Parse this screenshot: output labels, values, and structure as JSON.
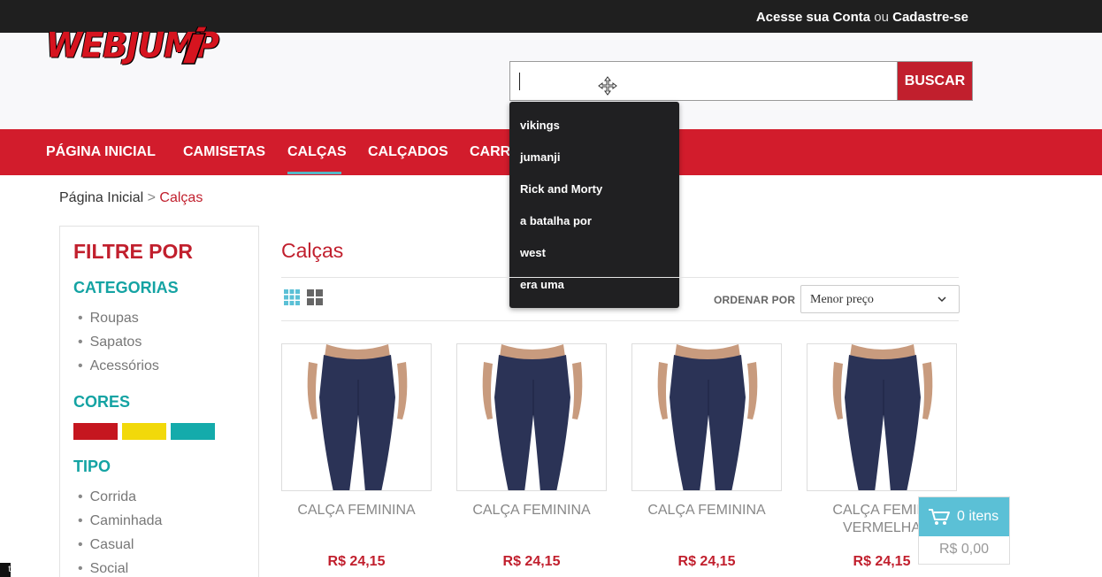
{
  "topbar": {
    "login_link": "Acesse sua Conta",
    "or_text": "ou",
    "register_link": "Cadastre-se"
  },
  "header": {
    "logo_text": "WEBJUMP",
    "search": {
      "value": "",
      "button_label": "BUSCAR"
    }
  },
  "nav": {
    "items": [
      {
        "label": "PÁGINA INICIAL",
        "active": false
      },
      {
        "label": "CAMISETAS",
        "active": false
      },
      {
        "label": "CALÇAS",
        "active": true
      },
      {
        "label": "CALÇADOS",
        "active": false
      },
      {
        "label": "CARRI",
        "active": false
      }
    ]
  },
  "search_suggestions": [
    "vikings",
    "jumanji",
    "Rick and Morty",
    "a batalha por",
    "west",
    "era uma"
  ],
  "breadcrumb": {
    "home": "Página Inicial",
    "separator": ">",
    "current": "Calças"
  },
  "sidebar": {
    "title": "FILTRE POR",
    "categories_heading": "CATEGORIAS",
    "categories": [
      "Roupas",
      "Sapatos",
      "Acessórios"
    ],
    "colors_heading": "CORES",
    "colors": [
      "#c5161f",
      "#f2d90a",
      "#14abab"
    ],
    "type_heading": "TIPO",
    "types": [
      "Corrida",
      "Caminhada",
      "Casual",
      "Social"
    ]
  },
  "main": {
    "title": "Calças",
    "sort_label": "ORDENAR POR",
    "sort_value": "Menor preço",
    "products": [
      {
        "name": "CALÇA FEMININA",
        "name2": "",
        "price": "R$ 24,15"
      },
      {
        "name": "CALÇA FEMININA",
        "name2": "",
        "price": "R$ 24,15"
      },
      {
        "name": "CALÇA FEMININA",
        "name2": "",
        "price": "R$ 24,15"
      },
      {
        "name": "CALÇA FEMINI",
        "name2": "VERMELHA",
        "price": "R$ 24,15"
      }
    ]
  },
  "cart": {
    "count_label": "0 itens",
    "total": "R$ 0,00"
  },
  "corner_tag": "t",
  "colors": {
    "brand_red": "#d21c2c",
    "accent_teal": "#14a3a3",
    "cart_blue": "#5bc0d6"
  }
}
